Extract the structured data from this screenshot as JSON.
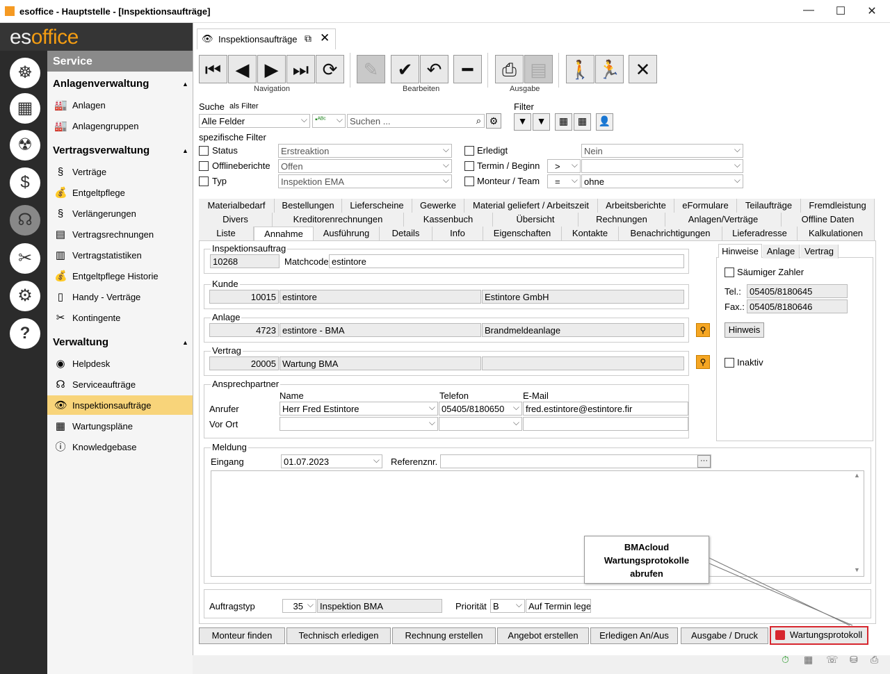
{
  "window": {
    "title": "esoffice - Hauptstelle - [Inspektionsaufträge]"
  },
  "logo": {
    "a": "es",
    "b": "office"
  },
  "nav": {
    "header": "Service",
    "sections": [
      {
        "title": "Anlagenverwaltung",
        "items": [
          "Anlagen",
          "Anlagengruppen"
        ]
      },
      {
        "title": "Vertragsverwaltung",
        "items": [
          "Verträge",
          "Entgeltpflege",
          "Verlängerungen",
          "Vertragsrechnungen",
          "Vertragstatistiken",
          "Entgeltpflege Historie",
          "Handy - Verträge",
          "Kontingente"
        ]
      },
      {
        "title": "Verwaltung",
        "items": [
          "Helpdesk",
          "Serviceaufträge",
          "Inspektionsaufträge",
          "Wartungspläne",
          "Knowledgebase"
        ]
      }
    ]
  },
  "tab": {
    "title": "Inspektionsaufträge"
  },
  "toolbar": {
    "navigation": "Navigation",
    "bearbeiten": "Bearbeiten",
    "ausgabe": "Ausgabe"
  },
  "search": {
    "label": "Suche",
    "as_filter": "als Filter",
    "field": "Alle Felder",
    "placeholder": "Suchen ...",
    "filter": "Filter"
  },
  "spec": {
    "label": "spezifische Filter",
    "status": "Status",
    "status_val": "Erstreaktion",
    "offline": "Offlineberichte",
    "offline_val": "Offen",
    "typ": "Typ",
    "typ_val": "Inspektion EMA",
    "erledigt": "Erledigt",
    "erledigt_val": "Nein",
    "termin": "Termin / Beginn",
    "termin_op": ">",
    "monteur": "Monteur / Team",
    "monteur_op": "=",
    "monteur_val": "ohne"
  },
  "tabs_row1": [
    "Materialbedarf",
    "Bestellungen",
    "Lieferscheine",
    "Gewerke",
    "Material geliefert / Arbeitszeit",
    "Arbeitsberichte",
    "eFormulare",
    "Teilaufträge",
    "Fremdleistung"
  ],
  "tabs_row2": [
    "Divers",
    "Kreditorenrechnungen",
    "Kassenbuch",
    "Übersicht",
    "Rechnungen",
    "Anlagen/Verträge",
    "Offline Daten"
  ],
  "tabs_row3": [
    "Liste",
    "Annahme",
    "Ausführung",
    "Details",
    "Info",
    "Eigenschaften",
    "Kontakte",
    "Benachrichtigungen",
    "Lieferadresse",
    "Kalkulationen"
  ],
  "form": {
    "ia_label": "Inspektionsauftrag",
    "ia_nr": "10268",
    "matchcode_label": "Matchcode",
    "matchcode": "estintore",
    "kunde_label": "Kunde",
    "kunde_nr": "10015",
    "kunde_match": "estintore",
    "kunde_name": "Estintore GmbH",
    "anlage_label": "Anlage",
    "anlage_nr": "4723",
    "anlage_match": "estintore - BMA",
    "anlage_name": "Brandmeldeanlage",
    "vertrag_label": "Vertrag",
    "vertrag_nr": "20005",
    "vertrag_name": "Wartung BMA",
    "ap_label": "Ansprechpartner",
    "name_h": "Name",
    "tel_h": "Telefon",
    "mail_h": "E-Mail",
    "anrufer": "Anrufer",
    "anrufer_name": "Herr Fred Estintore",
    "anrufer_tel": "05405/8180650",
    "anrufer_mail": "fred.estintore@estintore.fir",
    "vorort": "Vor Ort",
    "meldung_label": "Meldung",
    "eingang_label": "Eingang",
    "eingang": "01.07.2023",
    "ref_label": "Referenznr.",
    "auftragstyp_label": "Auftragstyp",
    "auftragstyp_nr": "35",
    "auftragstyp": "Inspektion BMA",
    "prio_label": "Priorität",
    "prio": "B",
    "auf_termin": "Auf Termin lege"
  },
  "side": {
    "tabs": [
      "Hinweise",
      "Anlage",
      "Vertrag"
    ],
    "saumig": "Säumiger Zahler",
    "tel_label": "Tel.:",
    "tel": "05405/8180645",
    "fax_label": "Fax.:",
    "fax": "05405/8180646",
    "hinweis_btn": "Hinweis",
    "inaktiv": "Inaktiv"
  },
  "callout": "BMAcloud\nWartungsprotokolle\nabrufen",
  "buttons": [
    "Monteur finden",
    "Technisch erledigen",
    "Rechnung erstellen",
    "Angebot erstellen",
    "Erledigen An/Aus",
    "Ausgabe / Druck",
    "Wartungsprotokoll"
  ]
}
